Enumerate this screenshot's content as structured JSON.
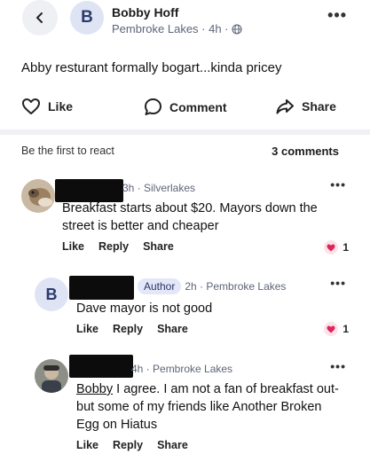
{
  "header": {
    "author_initial": "B",
    "author_name": "Bobby Hoff",
    "author_meta": "Pembroke Lakes · 4h ·"
  },
  "post": {
    "text": "Abby resturant formally bogart...kinda pricey"
  },
  "actions": {
    "like": "Like",
    "comment": "Comment",
    "share": "Share"
  },
  "summary": {
    "react_prompt": "Be the first to react",
    "comments_count": "3 comments"
  },
  "comments": [
    {
      "meta": "3h · Silverlakes",
      "text": "Breakfast starts about $20. Mayors down the street is better and cheaper",
      "like": "Like",
      "reply": "Reply",
      "share": "Share",
      "reactions": "1"
    },
    {
      "initial": "B",
      "badge": "Author",
      "meta": "2h · Pembroke Lakes",
      "text": "Dave mayor is not good",
      "like": "Like",
      "reply": "Reply",
      "share": "Share",
      "reactions": "1"
    },
    {
      "meta": "4h · Pembroke Lakes",
      "mention": "Bobby",
      "text": " I agree. I am not a fan of breakfast out-but some of my friends like Another Broken Egg on Hiatus",
      "like": "Like",
      "reply": "Reply",
      "share": "Share"
    }
  ],
  "colors": {
    "accent_avatar_bg": "#dfe4f5",
    "heart": "#e0245e",
    "redaction": "#0c0c0c"
  }
}
